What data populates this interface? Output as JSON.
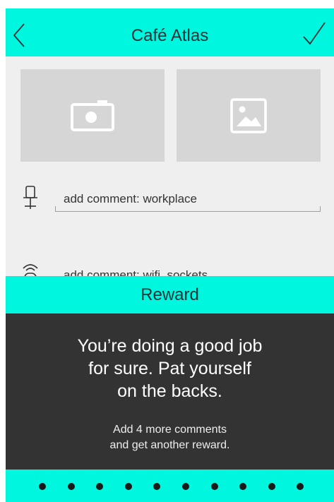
{
  "header": {
    "title": "Café Atlas",
    "back_icon": "chevron-left-icon",
    "done_icon": "checkmark-icon"
  },
  "photos": {
    "camera_icon": "camera-icon",
    "gallery_icon": "image-icon"
  },
  "comments": [
    {
      "icon": "desk-chair-icon",
      "value": "add comment: workplace"
    },
    {
      "icon": "wifi-router-icon",
      "value": "add comment: wifi, sockets"
    }
  ],
  "reward": {
    "title": "Reward",
    "message_line1": "You’re doing a good job",
    "message_line2": "for sure. Pat yourself",
    "message_line3": "on the backs.",
    "sub_line1": "Add 4 more comments",
    "sub_line2": "and get another reward."
  },
  "pager": {
    "dot_count": 10
  },
  "colors": {
    "accent": "#00f7df",
    "overlay": "#333333",
    "placeholder": "#d6d6d6",
    "background": "#efefef"
  }
}
